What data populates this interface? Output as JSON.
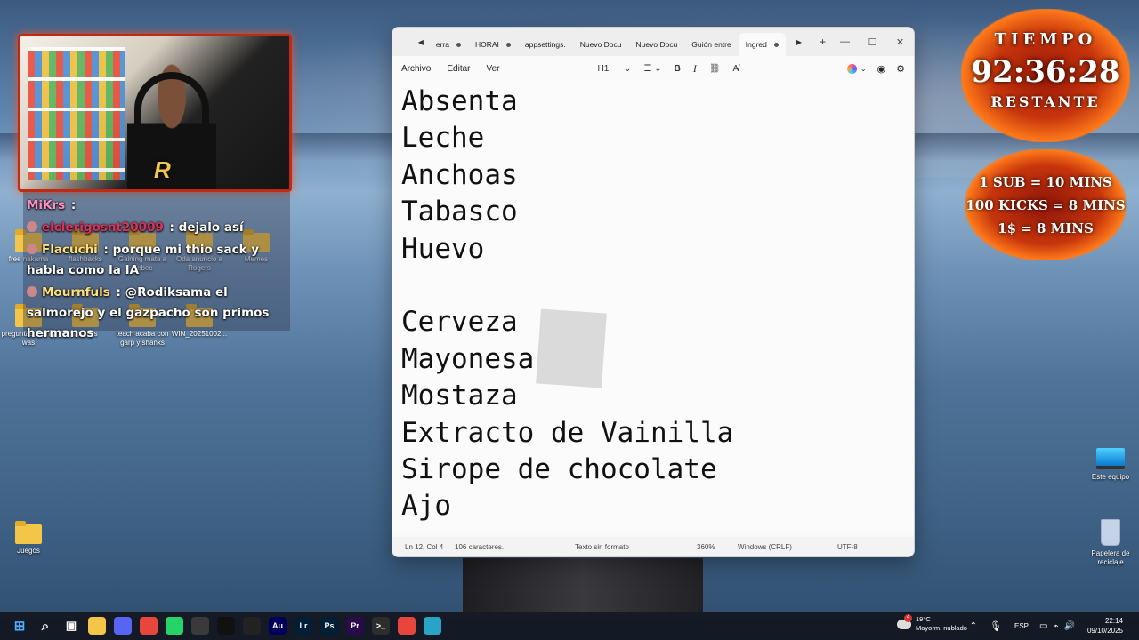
{
  "desktop": {
    "icons_left": [
      {
        "label": "free nakama"
      },
      {
        "label": "flashbacks"
      },
      {
        "label": "Gaining mata a Xebec"
      },
      {
        "label": "Oda anuncio a Rogers"
      },
      {
        "label": "Memes"
      },
      {
        "label": "preguntas flash y was"
      },
      {
        "label": "op clips"
      },
      {
        "label": "teach acaba con garp y shanks"
      },
      {
        "label": "WIN_20251002..."
      },
      {
        "label": "Juegos"
      }
    ],
    "icons_right": [
      {
        "label": "Este equipo"
      },
      {
        "label": "Papelera de reciclaje"
      }
    ]
  },
  "chat": {
    "messages": [
      {
        "user": "MiKrs",
        "sep": " :",
        "text": "",
        "user_color": "#ff8fbf"
      },
      {
        "user": "elclerigosnt20009",
        "sep": " : ",
        "text": "dejalo así",
        "user_color": "#e0305a"
      },
      {
        "user": "Flacuchi",
        "sep": " : ",
        "text": "porque mi thio sack y habla como la IA",
        "user_color": "#ffe07a"
      },
      {
        "user": "Mournfuls",
        "sep": " : ",
        "text": "@Rodiksama el salmorejo y el gazpacho son primos hermanos",
        "user_color": "#ffe07a"
      }
    ]
  },
  "timer": {
    "label_top": "TIEMPO",
    "value": "92:36:28",
    "label_bottom": "RESTANTE",
    "rates": [
      "1 SUB = 10 MINS",
      "100 KICKS = 8 MINS",
      "1$ = 8 MINS"
    ]
  },
  "notepad": {
    "tabs": [
      {
        "label": "erra"
      },
      {
        "label": "HORAI"
      },
      {
        "label": "appsettings."
      },
      {
        "label": "Nuevo Docu"
      },
      {
        "label": "Nuevo Docu"
      },
      {
        "label": "Guión entre"
      },
      {
        "label": "Ingred"
      }
    ],
    "menu": [
      "Archivo",
      "Editar",
      "Ver"
    ],
    "heading_tool": "H1",
    "lines": [
      "Absenta",
      "Leche",
      "Anchoas",
      "Tabasco",
      "Huevo",
      "",
      "Cerveza",
      "Mayonesa",
      "Mostaza",
      "Extracto de Vainilla",
      "Sirope de chocolate",
      "Ajo"
    ],
    "status": {
      "position": "Ln 12, Col 4",
      "chars": "106 caracteres.",
      "format": "Texto sin formato",
      "zoom": "360%",
      "line_ending": "Windows (CRLF)",
      "encoding": "UTF-8"
    }
  },
  "taskbar": {
    "weather_temp": "19°C",
    "weather_desc": "Mayorm. nublado",
    "weather_badge": "4",
    "lang": "ESP",
    "time": "22:14",
    "date": "09/10/2025",
    "apps": [
      {
        "icon": "windows-start-icon",
        "color": "#2b8df0"
      },
      {
        "icon": "search-icon",
        "color": "transparent"
      },
      {
        "icon": "task-view-icon",
        "color": "transparent"
      },
      {
        "icon": "file-explorer-icon",
        "color": "#f3c64a"
      },
      {
        "icon": "discord-icon",
        "color": "#5865f2"
      },
      {
        "icon": "chrome-icon",
        "color": "#e8453c"
      },
      {
        "icon": "whatsapp-icon",
        "color": "#25d366"
      },
      {
        "icon": "obs-icon",
        "color": "#3a3a3a"
      },
      {
        "icon": "tiktok-icon",
        "color": "#111111"
      },
      {
        "icon": "capcut-icon",
        "color": "#222222"
      },
      {
        "icon": "audition-icon",
        "color": "#00005b"
      },
      {
        "icon": "lightroom-icon",
        "color": "#001e36"
      },
      {
        "icon": "photoshop-icon",
        "color": "#001e36"
      },
      {
        "icon": "premiere-icon",
        "color": "#2a0a4a"
      },
      {
        "icon": "terminal-icon",
        "color": "#2d2d2d"
      },
      {
        "icon": "chrome-profile-icon",
        "color": "#e8453c"
      },
      {
        "icon": "notepad-icon",
        "color": "#2aa3c9"
      }
    ],
    "app_labels": [
      "",
      "",
      "",
      "",
      "",
      "",
      "",
      "",
      "",
      "",
      "Au",
      "Lr",
      "Ps",
      "Pr",
      "",
      "",
      ""
    ]
  }
}
